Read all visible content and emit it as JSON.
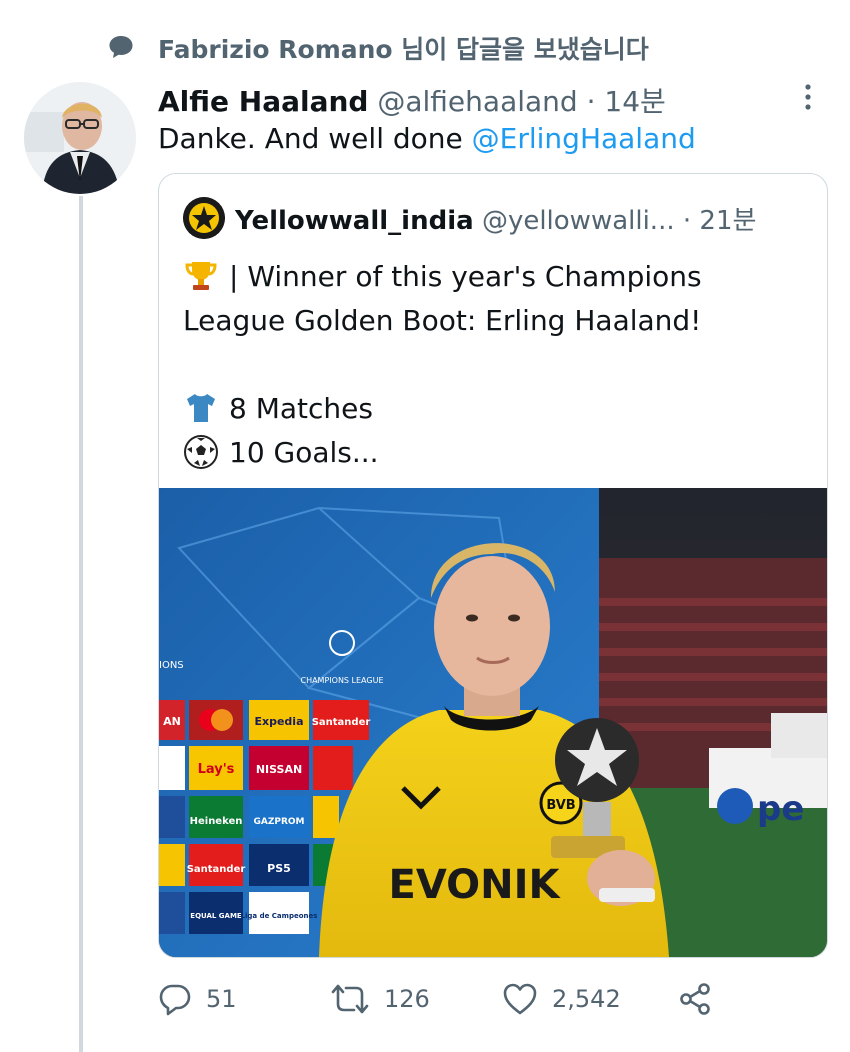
{
  "reply_context": {
    "text": "Fabrizio Romano 님이 답글을 보냈습니다"
  },
  "tweet": {
    "author_name": "Alfie Haaland",
    "author_handle": "@alfiehaaland",
    "separator": "·",
    "time": "14분",
    "text_prefix": "Danke. And well done ",
    "mention": "@ErlingHaaland"
  },
  "quoted": {
    "author_name": "Yellowwall_india",
    "author_handle": "@yellowwalli...",
    "separator": "·",
    "time": "21분",
    "line1": "| Winner of this year's Champions",
    "line2": "League Golden Boot: Erling Haaland!",
    "line3": "8 Matches",
    "line4": "10 Goals...",
    "emojis": [
      "trophy-icon",
      "shirt-icon",
      "soccer-ball-icon"
    ],
    "image": {
      "ucl_board_text": "CHAMPIONS LEAGUE",
      "board_edge_text": "IONS",
      "sponsors": [
        "AN",
        "Expedia",
        "Santander",
        "Lay's",
        "NISSAN",
        "Heineken",
        "GAZPROM",
        "Santander",
        "PS5",
        "EQUAL GAME",
        "Liga de Campeones"
      ],
      "shirt_text": "EVONIK",
      "badge_text": "BVB",
      "ad_text": "pe"
    }
  },
  "actions": {
    "reply_count": "51",
    "retweet_count": "126",
    "like_count": "2,542"
  },
  "colors": {
    "accent": "#1d9bf0",
    "muted": "#536471",
    "border": "#cfd9de"
  }
}
